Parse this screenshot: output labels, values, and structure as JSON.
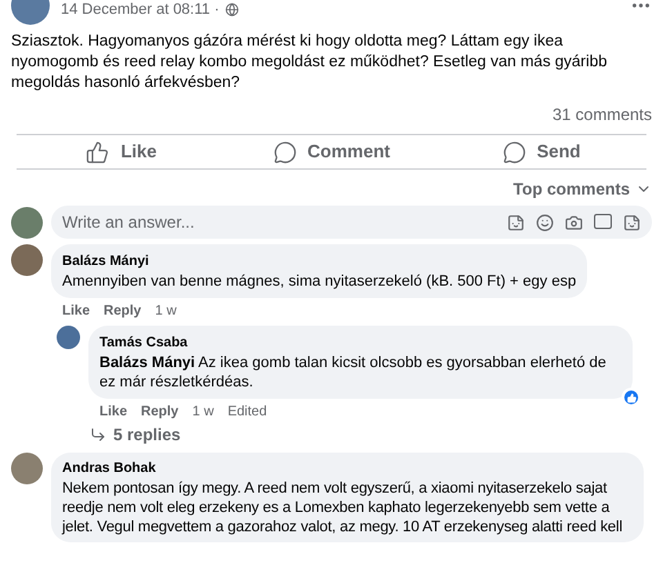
{
  "post": {
    "time": "14 December at 08:11 ·",
    "text": "Sziasztok. Hagyomanyos gázóra mérést ki hogy oldotta meg? Láttam egy ikea nyomogomb és reed relay kombo megoldást ez működhet? Esetleg van más gyáribb megoldás hasonló árfekvésben?",
    "comment_count": "31 comments"
  },
  "actions": [
    {
      "kind": "like",
      "label": "Like"
    },
    {
      "kind": "comment",
      "label": "Comment"
    },
    {
      "kind": "send",
      "label": "Send"
    }
  ],
  "sort": {
    "label": "Top comments"
  },
  "composer": {
    "placeholder": "Write an answer..."
  },
  "comments": [
    {
      "author": "Balázs Mányi",
      "text": "Amennyiben van benne mágnes, sima nyitaserzekeló (kB. 500 Ft) + egy esp",
      "like": "Like",
      "reply": "Reply",
      "age": "1 w",
      "replies": [
        {
          "author": "Tamás Csaba",
          "text": "**Balázs Mányi** Az ikea gomb talan kicsit olcsobb es gyorsabban elerhetó de ez már részletkérdéas.",
          "like": "Like",
          "reply": "Reply",
          "age": "1 w",
          "edited": "Edited",
          "liked": true
        }
      ],
      "more_replies": "5 replies"
    },
    {
      "author": "Andras Bohak",
      "text": "Nekem pontosan így megy. A reed nem volt egyszerű, a xiaomi nyitaserzekelo sajat reedje nem volt eleg erzekeny es a Lomexben kaphato legerzekenyebb sem vette a jelet. Vegul megvettem a gazorahoz valot, az megy. 10 AT erzekenyseg alatti reed kell"
    }
  ]
}
